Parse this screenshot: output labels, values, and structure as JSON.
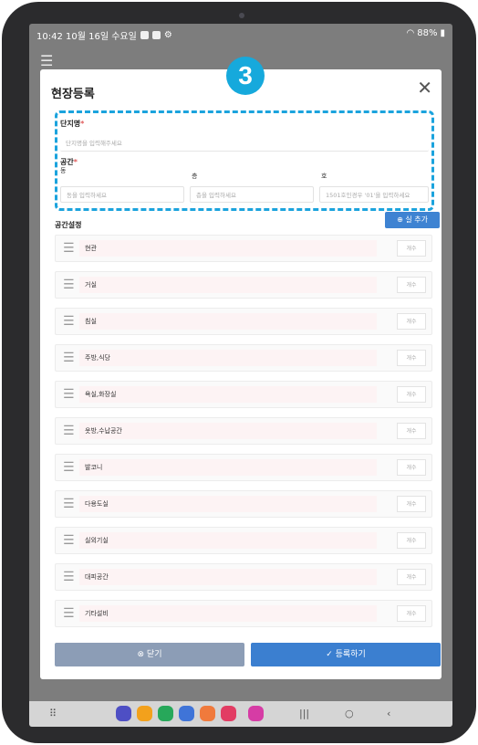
{
  "status_bar": {
    "time_date": "10:42  10월 16일 수요일",
    "right_status": "88%"
  },
  "step_badge": "3",
  "modal": {
    "title": "현장등록",
    "complex_name": {
      "label": "단지명",
      "placeholder": "단지명을 입력해주세요"
    },
    "space": {
      "label": "공간",
      "dong": {
        "label": "동",
        "placeholder": "동을 입력하세요"
      },
      "floor": {
        "label": "층",
        "placeholder": "층을 입력하세요"
      },
      "unit": {
        "label": "호",
        "placeholder": "1501호인경우 '01'을 입력하세요"
      }
    },
    "space_settings": {
      "label": "공간설정",
      "add_button": "실 추가",
      "rows": [
        {
          "name": "현관",
          "count": "개수"
        },
        {
          "name": "거실",
          "count": "개수"
        },
        {
          "name": "침실",
          "count": "개수"
        },
        {
          "name": "주방,식당",
          "count": "개수"
        },
        {
          "name": "욕실,화장실",
          "count": "개수"
        },
        {
          "name": "옷방,수납공간",
          "count": "개수"
        },
        {
          "name": "발코니",
          "count": "개수"
        },
        {
          "name": "다용도실",
          "count": "개수"
        },
        {
          "name": "실외기실",
          "count": "개수"
        },
        {
          "name": "대피공간",
          "count": "개수"
        },
        {
          "name": "기타설비",
          "count": "개수"
        }
      ]
    },
    "buttons": {
      "close": "닫기",
      "register": "등록하기"
    }
  },
  "colors": {
    "accent": "#3b7fd0",
    "close_button": "#8c9db6",
    "badge": "#16a9dc",
    "dashed_highlight": "#1ba3dd",
    "required_mark": "#e05a5a"
  },
  "icons": {
    "close": "close-icon",
    "add": "plus-circle-icon",
    "drag": "drag-handle-icon",
    "close_button": "x-circle-icon",
    "register_button": "check-circle-icon"
  }
}
